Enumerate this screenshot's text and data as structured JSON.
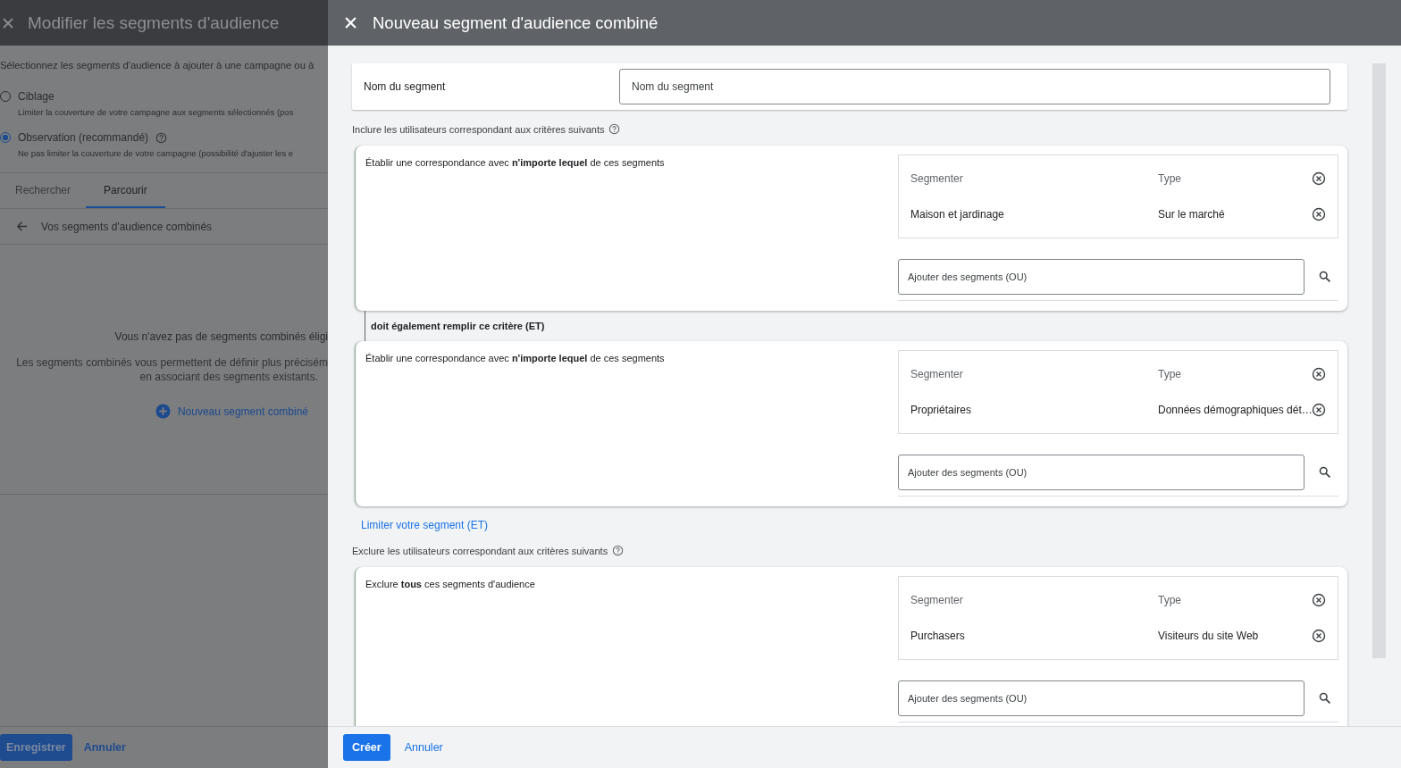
{
  "left_panel": {
    "title": "Modifier les segments d'audience",
    "intro": "Sélectionnez les segments d'audience à ajouter à une campagne ou à",
    "options": [
      {
        "label": "Ciblage",
        "description": "Limiter la couverture de votre campagne aux segments sélectionnés (pos",
        "help": false,
        "selected": false
      },
      {
        "label": "Observation (recommandé)",
        "description": "Ne pas limiter la couverture de votre campagne (possibilité d'ajuster les e",
        "help": true,
        "selected": true
      }
    ],
    "tabs": [
      {
        "label": "Rechercher",
        "selected": false
      },
      {
        "label": "Parcourir",
        "selected": true
      }
    ],
    "breadcrumb": "Vos segments d'audience combinés",
    "empty_title": "Vous n'avez pas de segments combinés éligi",
    "empty_lines": [
      "Les segments combinés vous permettent de définir plus précisém",
      "en associant des segments existants."
    ],
    "empty_action": "Nouveau segment combiné",
    "buttons": [
      {
        "label": "Enregistrer",
        "kind": "primary"
      },
      {
        "label": "Annuler",
        "kind": "text"
      }
    ]
  },
  "dialog": {
    "title": "Nouveau segment d'audience combiné",
    "segment_name": {
      "label": "Nom du segment",
      "placeholder": "Nom du segment"
    },
    "include": {
      "heading": "Inclure les utilisateurs correspondant aux critères suivants",
      "connector": "doit également remplir ce critère (ET)",
      "groups": [
        {
          "rule": "Établir une correspondance avec **n'importe lequel** de ces segments",
          "columns": [
            "Segmenter",
            "Type"
          ],
          "rows": [
            {
              "segment": "Maison et jardinage",
              "type": "Sur le marché"
            }
          ],
          "search_placeholder": "Ajouter des segments (OU)"
        },
        {
          "rule": "Établir une correspondance avec **n'importe lequel** de ces segments",
          "columns": [
            "Segmenter",
            "Type"
          ],
          "rows": [
            {
              "segment": "Propriétaires",
              "type": "Données démographiques dét…"
            }
          ],
          "search_placeholder": "Ajouter des segments (OU)"
        }
      ]
    },
    "narrow_link": "Limiter votre segment (ET)",
    "exclude": {
      "heading": "Exclure les utilisateurs correspondant aux critères suivants",
      "groups": [
        {
          "rule": "Exclure **tous** ces segments d'audience",
          "columns": [
            "Segmenter",
            "Type"
          ],
          "rows": [
            {
              "segment": "Purchasers",
              "type": "Visiteurs du site Web"
            }
          ],
          "search_placeholder": "Ajouter des segments (OU)"
        }
      ]
    },
    "buttons": [
      {
        "label": "Créer",
        "kind": "primary"
      },
      {
        "label": "Annuler",
        "kind": "text"
      }
    ]
  }
}
